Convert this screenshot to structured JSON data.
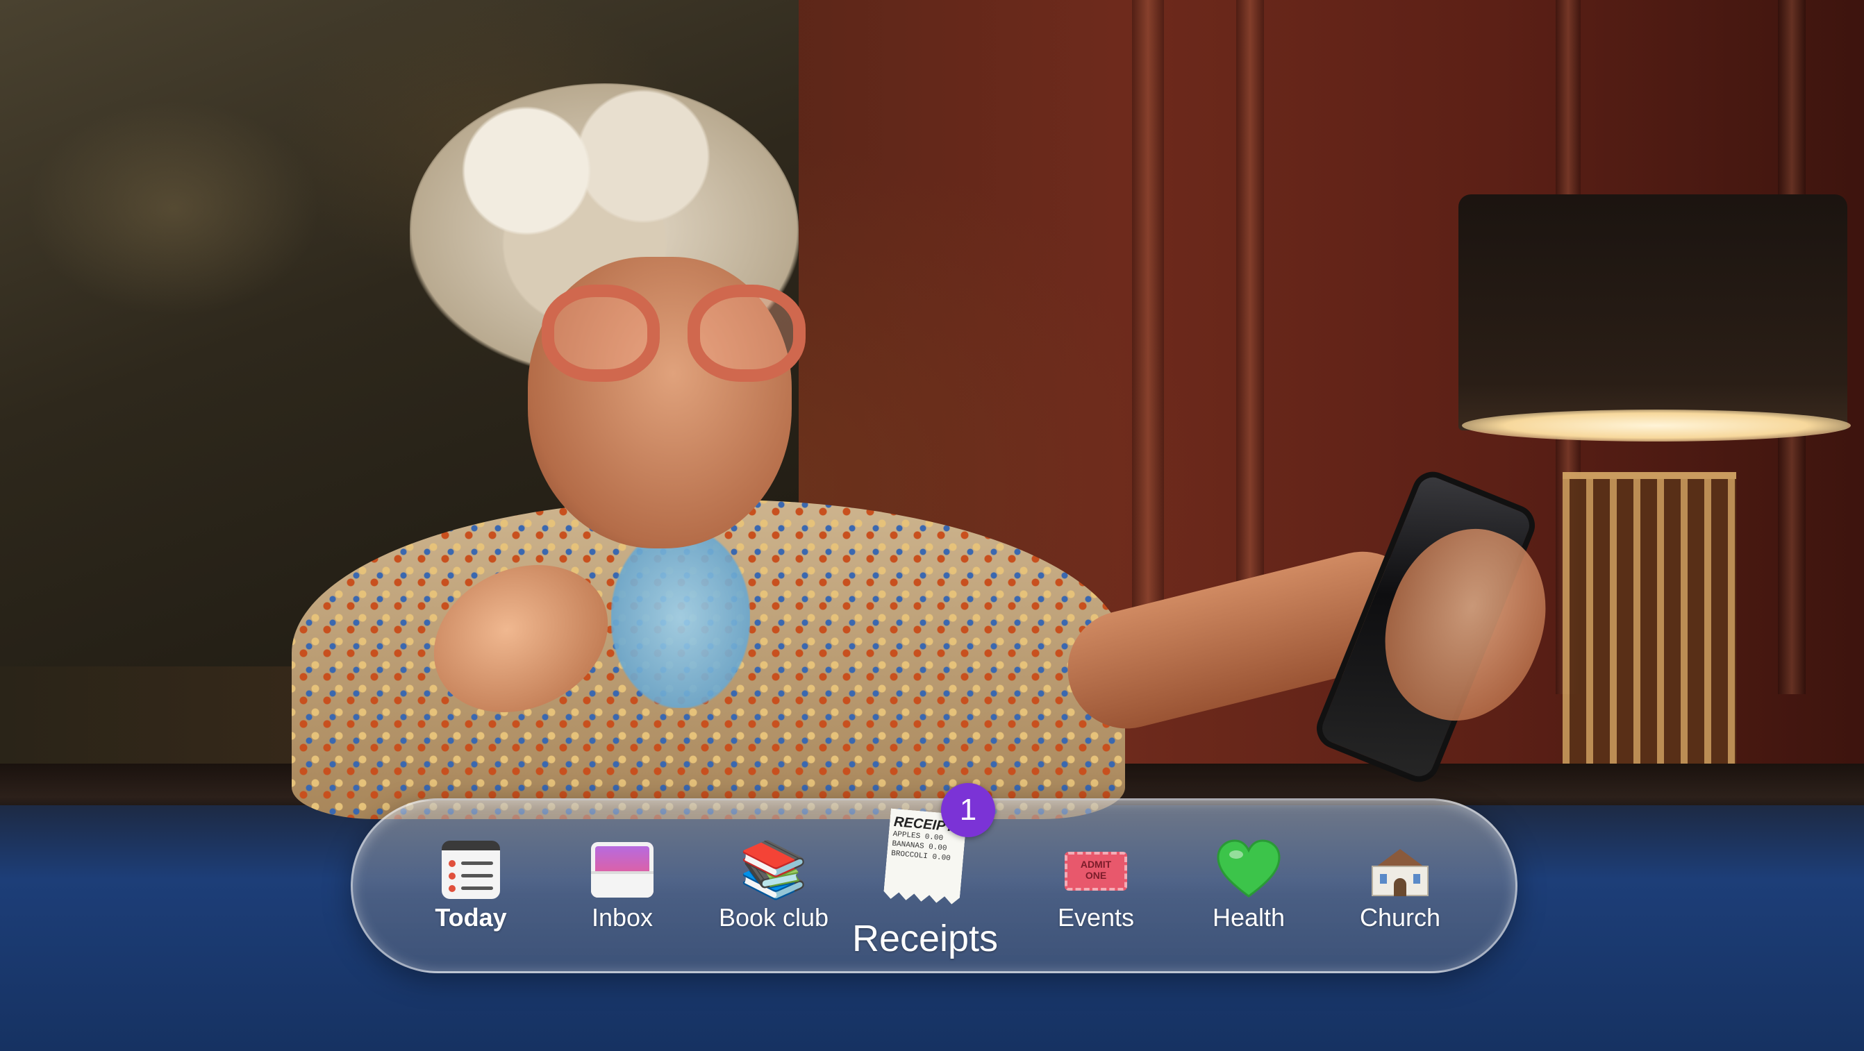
{
  "dock": {
    "items": [
      {
        "label": "Today",
        "icon": "today-list-icon",
        "active": true
      },
      {
        "label": "Inbox",
        "icon": "inbox-tray-icon"
      },
      {
        "label": "Book club",
        "icon": "books-icon"
      },
      {
        "label": "Receipts",
        "icon": "receipt-icon",
        "focused": true,
        "badge": "1"
      },
      {
        "label": "Events",
        "icon": "ticket-icon"
      },
      {
        "label": "Health",
        "icon": "green-heart-icon"
      },
      {
        "label": "Church",
        "icon": "church-icon"
      }
    ],
    "receipt_icon": {
      "title": "RECEIPT",
      "lines": [
        "APPLES   0.00",
        "BANANAS  0.00",
        "BROCCOLI 0.00"
      ]
    },
    "ticket_icon_text": [
      "ADMIT",
      "ONE"
    ]
  },
  "colors": {
    "badge": "#7b33d6",
    "label": "#ffffff",
    "heart": "#3cc44a"
  }
}
